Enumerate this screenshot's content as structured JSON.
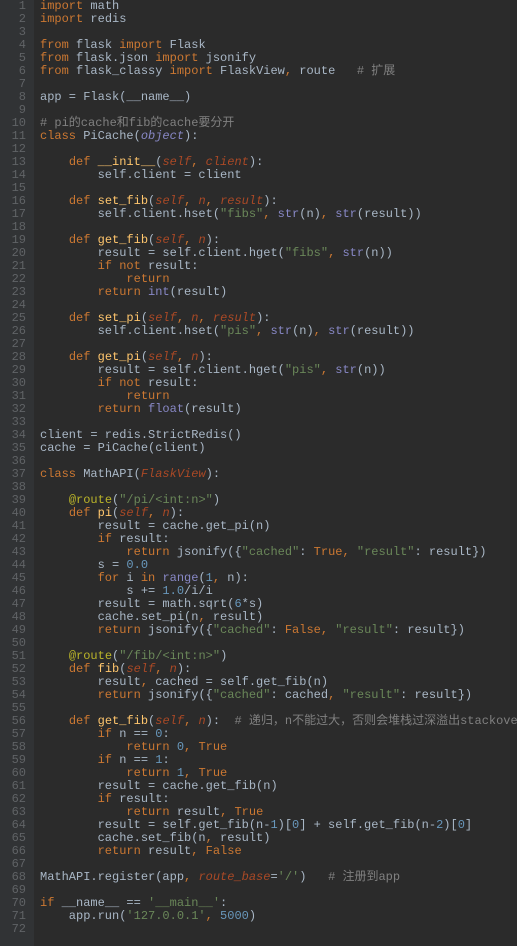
{
  "lines": [
    {
      "n": 1,
      "t": [
        [
          "k",
          "import"
        ],
        [
          "o",
          " math"
        ]
      ]
    },
    {
      "n": 2,
      "t": [
        [
          "k",
          "import"
        ],
        [
          "o",
          " redis"
        ]
      ]
    },
    {
      "n": 3,
      "t": []
    },
    {
      "n": 4,
      "t": [
        [
          "k",
          "from"
        ],
        [
          "o",
          " flask "
        ],
        [
          "k",
          "import"
        ],
        [
          "o",
          " Flask"
        ]
      ]
    },
    {
      "n": 5,
      "t": [
        [
          "k",
          "from"
        ],
        [
          "o",
          " flask.json "
        ],
        [
          "k",
          "import"
        ],
        [
          "o",
          " jsonify"
        ]
      ]
    },
    {
      "n": 6,
      "t": [
        [
          "k",
          "from"
        ],
        [
          "o",
          " flask_classy "
        ],
        [
          "k",
          "import"
        ],
        [
          "o",
          " FlaskView"
        ],
        [
          "k",
          ","
        ],
        [
          "o",
          " route   "
        ],
        [
          "c",
          "# 扩展"
        ]
      ]
    },
    {
      "n": 7,
      "t": []
    },
    {
      "n": 8,
      "t": [
        [
          "o",
          "app = Flask(__name__)"
        ]
      ]
    },
    {
      "n": 9,
      "t": []
    },
    {
      "n": 10,
      "t": [
        [
          "c",
          "# pi的cache和fib的cache要分开"
        ]
      ]
    },
    {
      "n": 11,
      "t": [
        [
          "k",
          "class "
        ],
        [
          "o",
          "PiCache("
        ],
        [
          "b i",
          "object"
        ],
        [
          "o",
          "):"
        ]
      ]
    },
    {
      "n": 12,
      "t": []
    },
    {
      "n": 13,
      "t": [
        [
          "o",
          "    "
        ],
        [
          "k",
          "def "
        ],
        [
          "f",
          "__init__"
        ],
        [
          "o",
          "("
        ],
        [
          "p i",
          "self"
        ],
        [
          "k",
          ","
        ],
        [
          "o",
          " "
        ],
        [
          "p i",
          "client"
        ],
        [
          "o",
          "):"
        ]
      ]
    },
    {
      "n": 14,
      "t": [
        [
          "o",
          "        self.client = client"
        ]
      ]
    },
    {
      "n": 15,
      "t": []
    },
    {
      "n": 16,
      "t": [
        [
          "o",
          "    "
        ],
        [
          "k",
          "def "
        ],
        [
          "f",
          "set_fib"
        ],
        [
          "o",
          "("
        ],
        [
          "p i",
          "self"
        ],
        [
          "k",
          ","
        ],
        [
          "o",
          " "
        ],
        [
          "p i",
          "n"
        ],
        [
          "k",
          ","
        ],
        [
          "o",
          " "
        ],
        [
          "p i",
          "result"
        ],
        [
          "o",
          "):"
        ]
      ]
    },
    {
      "n": 17,
      "t": [
        [
          "o",
          "        self.client.hset("
        ],
        [
          "s",
          "\"fibs\""
        ],
        [
          "k",
          ","
        ],
        [
          "o",
          " "
        ],
        [
          "b",
          "str"
        ],
        [
          "o",
          "(n)"
        ],
        [
          "k",
          ","
        ],
        [
          "o",
          " "
        ],
        [
          "b",
          "str"
        ],
        [
          "o",
          "(result))"
        ]
      ]
    },
    {
      "n": 18,
      "t": []
    },
    {
      "n": 19,
      "t": [
        [
          "o",
          "    "
        ],
        [
          "k",
          "def "
        ],
        [
          "f",
          "get_fib"
        ],
        [
          "o",
          "("
        ],
        [
          "p i",
          "self"
        ],
        [
          "k",
          ","
        ],
        [
          "o",
          " "
        ],
        [
          "p i",
          "n"
        ],
        [
          "o",
          "):"
        ]
      ]
    },
    {
      "n": 20,
      "t": [
        [
          "o",
          "        result = self.client.hget("
        ],
        [
          "s",
          "\"fibs\""
        ],
        [
          "k",
          ","
        ],
        [
          "o",
          " "
        ],
        [
          "b",
          "str"
        ],
        [
          "o",
          "(n))"
        ]
      ]
    },
    {
      "n": 21,
      "t": [
        [
          "o",
          "        "
        ],
        [
          "k",
          "if not "
        ],
        [
          "o",
          "result:"
        ]
      ]
    },
    {
      "n": 22,
      "t": [
        [
          "o",
          "            "
        ],
        [
          "k",
          "return"
        ]
      ]
    },
    {
      "n": 23,
      "t": [
        [
          "o",
          "        "
        ],
        [
          "k",
          "return "
        ],
        [
          "b",
          "int"
        ],
        [
          "o",
          "(result)"
        ]
      ]
    },
    {
      "n": 24,
      "t": []
    },
    {
      "n": 25,
      "t": [
        [
          "o",
          "    "
        ],
        [
          "k",
          "def "
        ],
        [
          "f",
          "set_pi"
        ],
        [
          "o",
          "("
        ],
        [
          "p i",
          "self"
        ],
        [
          "k",
          ","
        ],
        [
          "o",
          " "
        ],
        [
          "p i",
          "n"
        ],
        [
          "k",
          ","
        ],
        [
          "o",
          " "
        ],
        [
          "p i",
          "result"
        ],
        [
          "o",
          "):"
        ]
      ]
    },
    {
      "n": 26,
      "t": [
        [
          "o",
          "        self.client.hset("
        ],
        [
          "s",
          "\"pis\""
        ],
        [
          "k",
          ","
        ],
        [
          "o",
          " "
        ],
        [
          "b",
          "str"
        ],
        [
          "o",
          "(n)"
        ],
        [
          "k",
          ","
        ],
        [
          "o",
          " "
        ],
        [
          "b",
          "str"
        ],
        [
          "o",
          "(result))"
        ]
      ]
    },
    {
      "n": 27,
      "t": []
    },
    {
      "n": 28,
      "t": [
        [
          "o",
          "    "
        ],
        [
          "k",
          "def "
        ],
        [
          "f",
          "get_pi"
        ],
        [
          "o",
          "("
        ],
        [
          "p i",
          "self"
        ],
        [
          "k",
          ","
        ],
        [
          "o",
          " "
        ],
        [
          "p i",
          "n"
        ],
        [
          "o",
          "):"
        ]
      ]
    },
    {
      "n": 29,
      "t": [
        [
          "o",
          "        result = self.client.hget("
        ],
        [
          "s",
          "\"pis\""
        ],
        [
          "k",
          ","
        ],
        [
          "o",
          " "
        ],
        [
          "b",
          "str"
        ],
        [
          "o",
          "(n))"
        ]
      ]
    },
    {
      "n": 30,
      "t": [
        [
          "o",
          "        "
        ],
        [
          "k",
          "if not "
        ],
        [
          "o",
          "result:"
        ]
      ]
    },
    {
      "n": 31,
      "t": [
        [
          "o",
          "            "
        ],
        [
          "k",
          "return"
        ]
      ]
    },
    {
      "n": 32,
      "t": [
        [
          "o",
          "        "
        ],
        [
          "k",
          "return "
        ],
        [
          "b",
          "float"
        ],
        [
          "o",
          "(result)"
        ]
      ]
    },
    {
      "n": 33,
      "t": []
    },
    {
      "n": 34,
      "t": [
        [
          "o",
          "client = redis.StrictRedis()"
        ]
      ]
    },
    {
      "n": 35,
      "t": [
        [
          "o",
          "cache = PiCache(client)"
        ]
      ]
    },
    {
      "n": 36,
      "t": []
    },
    {
      "n": 37,
      "t": [
        [
          "k",
          "class "
        ],
        [
          "o",
          "MathAPI("
        ],
        [
          "p i",
          "FlaskView"
        ],
        [
          "o",
          "):"
        ]
      ]
    },
    {
      "n": 38,
      "t": []
    },
    {
      "n": 39,
      "t": [
        [
          "o",
          "    "
        ],
        [
          "d",
          "@route"
        ],
        [
          "o",
          "("
        ],
        [
          "s",
          "\"/pi/<int:n>\""
        ],
        [
          "o",
          ")"
        ]
      ]
    },
    {
      "n": 40,
      "t": [
        [
          "o",
          "    "
        ],
        [
          "k",
          "def "
        ],
        [
          "f",
          "pi"
        ],
        [
          "o",
          "("
        ],
        [
          "p i",
          "self"
        ],
        [
          "k",
          ","
        ],
        [
          "o",
          " "
        ],
        [
          "p i",
          "n"
        ],
        [
          "o",
          "):"
        ]
      ]
    },
    {
      "n": 41,
      "t": [
        [
          "o",
          "        result = cache.get_pi(n)"
        ]
      ]
    },
    {
      "n": 42,
      "t": [
        [
          "o",
          "        "
        ],
        [
          "k",
          "if "
        ],
        [
          "o",
          "result:"
        ]
      ]
    },
    {
      "n": 43,
      "t": [
        [
          "o",
          "            "
        ],
        [
          "k",
          "return "
        ],
        [
          "o",
          "jsonify({"
        ],
        [
          "s",
          "\"cached\""
        ],
        [
          "o",
          ": "
        ],
        [
          "k",
          "True"
        ],
        [
          "k",
          ","
        ],
        [
          "o",
          " "
        ],
        [
          "s",
          "\"result\""
        ],
        [
          "o",
          ": result})"
        ]
      ]
    },
    {
      "n": 44,
      "t": [
        [
          "o",
          "        s = "
        ],
        [
          "n",
          "0.0"
        ]
      ]
    },
    {
      "n": 45,
      "t": [
        [
          "o",
          "        "
        ],
        [
          "k",
          "for "
        ],
        [
          "o",
          "i "
        ],
        [
          "k",
          "in "
        ],
        [
          "b",
          "range"
        ],
        [
          "o",
          "("
        ],
        [
          "n",
          "1"
        ],
        [
          "k",
          ","
        ],
        [
          "o",
          " n):"
        ]
      ]
    },
    {
      "n": 46,
      "t": [
        [
          "o",
          "            s += "
        ],
        [
          "n",
          "1.0"
        ],
        [
          "o",
          "/i/i"
        ]
      ]
    },
    {
      "n": 47,
      "t": [
        [
          "o",
          "        result = math.sqrt("
        ],
        [
          "n",
          "6"
        ],
        [
          "o",
          "*s)"
        ]
      ]
    },
    {
      "n": 48,
      "t": [
        [
          "o",
          "        cache.set_pi(n"
        ],
        [
          "k",
          ","
        ],
        [
          "o",
          " result)"
        ]
      ]
    },
    {
      "n": 49,
      "t": [
        [
          "o",
          "        "
        ],
        [
          "k",
          "return "
        ],
        [
          "o",
          "jsonify({"
        ],
        [
          "s",
          "\"cached\""
        ],
        [
          "o",
          ": "
        ],
        [
          "k",
          "False"
        ],
        [
          "k",
          ","
        ],
        [
          "o",
          " "
        ],
        [
          "s",
          "\"result\""
        ],
        [
          "o",
          ": result})"
        ]
      ]
    },
    {
      "n": 50,
      "t": []
    },
    {
      "n": 51,
      "t": [
        [
          "o",
          "    "
        ],
        [
          "d",
          "@route"
        ],
        [
          "o",
          "("
        ],
        [
          "s",
          "\"/fib/<int:n>\""
        ],
        [
          "o",
          ")"
        ]
      ]
    },
    {
      "n": 52,
      "t": [
        [
          "o",
          "    "
        ],
        [
          "k",
          "def "
        ],
        [
          "f",
          "fib"
        ],
        [
          "o",
          "("
        ],
        [
          "p i",
          "self"
        ],
        [
          "k",
          ","
        ],
        [
          "o",
          " "
        ],
        [
          "p i",
          "n"
        ],
        [
          "o",
          "):"
        ]
      ]
    },
    {
      "n": 53,
      "t": [
        [
          "o",
          "        result"
        ],
        [
          "k",
          ","
        ],
        [
          "o",
          " cached = self.get_fib(n)"
        ]
      ]
    },
    {
      "n": 54,
      "t": [
        [
          "o",
          "        "
        ],
        [
          "k",
          "return "
        ],
        [
          "o",
          "jsonify({"
        ],
        [
          "s",
          "\"cached\""
        ],
        [
          "o",
          ": cached"
        ],
        [
          "k",
          ","
        ],
        [
          "o",
          " "
        ],
        [
          "s",
          "\"result\""
        ],
        [
          "o",
          ": result})"
        ]
      ]
    },
    {
      "n": 55,
      "t": []
    },
    {
      "n": 56,
      "t": [
        [
          "o",
          "    "
        ],
        [
          "k",
          "def "
        ],
        [
          "f",
          "get_fib"
        ],
        [
          "o",
          "("
        ],
        [
          "p i",
          "self"
        ],
        [
          "k",
          ","
        ],
        [
          "o",
          " "
        ],
        [
          "p i",
          "n"
        ],
        [
          "o",
          "):  "
        ],
        [
          "c",
          "# 递归，n不能过大，否则会堆栈过深溢出stackoverflow"
        ]
      ]
    },
    {
      "n": 57,
      "t": [
        [
          "o",
          "        "
        ],
        [
          "k",
          "if "
        ],
        [
          "o",
          "n == "
        ],
        [
          "n",
          "0"
        ],
        [
          "o",
          ":"
        ]
      ]
    },
    {
      "n": 58,
      "t": [
        [
          "o",
          "            "
        ],
        [
          "k",
          "return "
        ],
        [
          "n",
          "0"
        ],
        [
          "k",
          ","
        ],
        [
          "o",
          " "
        ],
        [
          "k",
          "True"
        ]
      ]
    },
    {
      "n": 59,
      "t": [
        [
          "o",
          "        "
        ],
        [
          "k",
          "if "
        ],
        [
          "o",
          "n == "
        ],
        [
          "n",
          "1"
        ],
        [
          "o",
          ":"
        ]
      ]
    },
    {
      "n": 60,
      "t": [
        [
          "o",
          "            "
        ],
        [
          "k",
          "return "
        ],
        [
          "n",
          "1"
        ],
        [
          "k",
          ","
        ],
        [
          "o",
          " "
        ],
        [
          "k",
          "True"
        ]
      ]
    },
    {
      "n": 61,
      "t": [
        [
          "o",
          "        result = cache.get_fib(n)"
        ]
      ]
    },
    {
      "n": 62,
      "t": [
        [
          "o",
          "        "
        ],
        [
          "k",
          "if "
        ],
        [
          "o",
          "result:"
        ]
      ]
    },
    {
      "n": 63,
      "t": [
        [
          "o",
          "            "
        ],
        [
          "k",
          "return "
        ],
        [
          "o",
          "result"
        ],
        [
          "k",
          ","
        ],
        [
          "o",
          " "
        ],
        [
          "k",
          "True"
        ]
      ]
    },
    {
      "n": 64,
      "t": [
        [
          "o",
          "        result = self.get_fib(n-"
        ],
        [
          "n",
          "1"
        ],
        [
          "o",
          ")["
        ],
        [
          "n",
          "0"
        ],
        [
          "o",
          "] + self.get_fib(n-"
        ],
        [
          "n",
          "2"
        ],
        [
          "o",
          ")["
        ],
        [
          "n",
          "0"
        ],
        [
          "o",
          "]"
        ]
      ]
    },
    {
      "n": 65,
      "t": [
        [
          "o",
          "        cache.set_fib(n"
        ],
        [
          "k",
          ","
        ],
        [
          "o",
          " result)"
        ]
      ]
    },
    {
      "n": 66,
      "t": [
        [
          "o",
          "        "
        ],
        [
          "k",
          "return "
        ],
        [
          "o",
          "result"
        ],
        [
          "k",
          ","
        ],
        [
          "o",
          " "
        ],
        [
          "k",
          "False"
        ]
      ]
    },
    {
      "n": 67,
      "t": []
    },
    {
      "n": 68,
      "t": [
        [
          "o",
          "MathAPI.register(app"
        ],
        [
          "k",
          ","
        ],
        [
          "o",
          " "
        ],
        [
          "p i",
          "route_base"
        ],
        [
          "o",
          "="
        ],
        [
          "s",
          "'/'"
        ],
        [
          "o",
          ")   "
        ],
        [
          "c",
          "# 注册到app"
        ]
      ]
    },
    {
      "n": 69,
      "t": []
    },
    {
      "n": 70,
      "t": [
        [
          "k",
          "if "
        ],
        [
          "o",
          "__name__ == "
        ],
        [
          "s",
          "'__main__'"
        ],
        [
          "o",
          ":"
        ]
      ]
    },
    {
      "n": 71,
      "t": [
        [
          "o",
          "    app.run("
        ],
        [
          "s",
          "'127.0.0.1'"
        ],
        [
          "k",
          ","
        ],
        [
          "o",
          " "
        ],
        [
          "n",
          "5000"
        ],
        [
          "o",
          ")"
        ]
      ]
    },
    {
      "n": 72,
      "t": []
    }
  ]
}
